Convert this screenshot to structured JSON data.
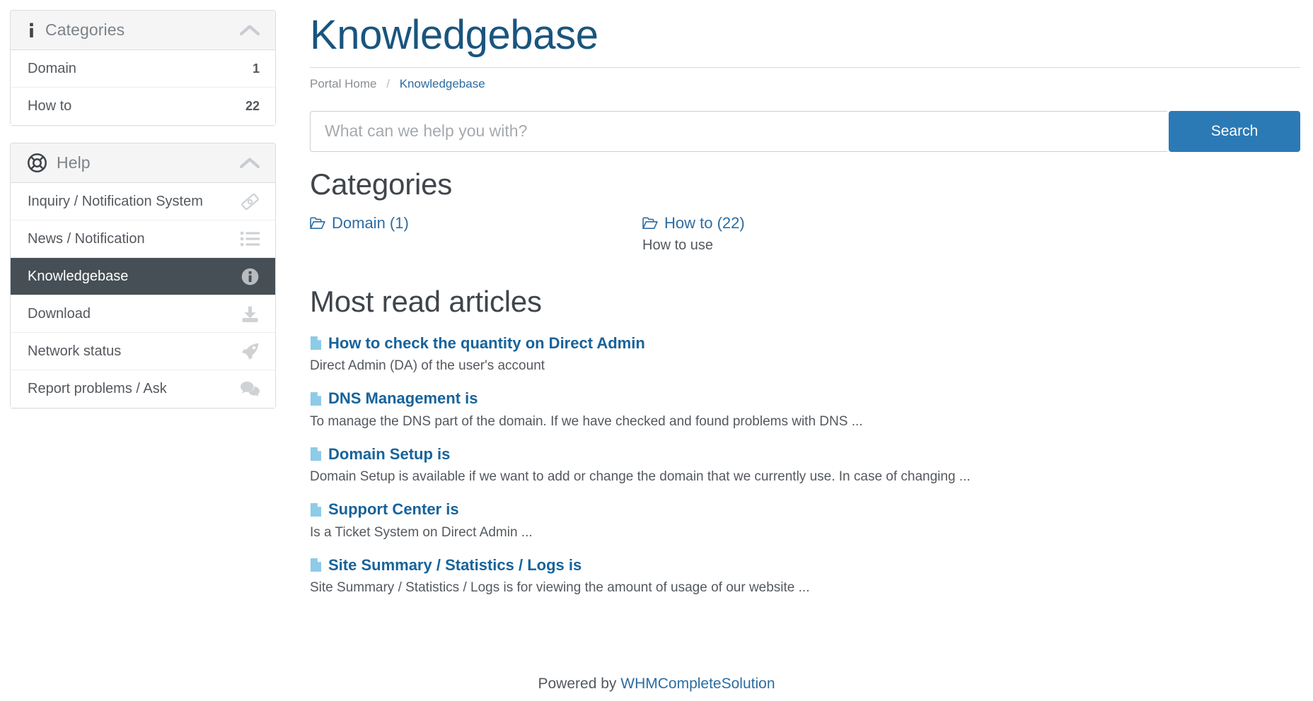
{
  "sidebar": {
    "categories_panel": {
      "title": "Categories",
      "icon": "info-icon",
      "collapse_icon": "chevron-up-icon",
      "items": [
        {
          "label": "Domain",
          "count": "1"
        },
        {
          "label": "How to",
          "count": "22"
        }
      ]
    },
    "help_panel": {
      "title": "Help",
      "icon": "life-ring-icon",
      "collapse_icon": "chevron-up-icon",
      "items": [
        {
          "label": "Inquiry / Notification System",
          "icon": "ticket-icon",
          "active": false
        },
        {
          "label": "News / Notification",
          "icon": "list-icon",
          "active": false
        },
        {
          "label": "Knowledgebase",
          "icon": "info-circle-icon",
          "active": true
        },
        {
          "label": "Download",
          "icon": "download-inbox-icon",
          "active": false
        },
        {
          "label": "Network status",
          "icon": "rocket-icon",
          "active": false
        },
        {
          "label": "Report problems / Ask",
          "icon": "comments-icon",
          "active": false
        }
      ]
    }
  },
  "main": {
    "page_title": "Knowledgebase",
    "breadcrumb": {
      "home": "Portal Home",
      "separator": "/",
      "current": "Knowledgebase"
    },
    "search": {
      "placeholder": "What can we help you with?",
      "value": "",
      "button_label": "Search"
    },
    "categories_heading": "Categories",
    "categories": [
      {
        "label": "Domain (1)",
        "description": "",
        "icon": "open-folder-icon"
      },
      {
        "label": "How to (22)",
        "description": "How to use",
        "icon": "open-folder-icon"
      }
    ],
    "articles_heading": "Most read articles",
    "articles": [
      {
        "title": "How to check the quantity on Direct Admin",
        "description": "Direct Admin (DA) of the user's account",
        "icon": "file-icon"
      },
      {
        "title": "DNS Management is",
        "description": "To manage the DNS part of the domain. If we have checked and found problems with DNS ...",
        "icon": "file-icon"
      },
      {
        "title": "Domain Setup is",
        "description": "Domain Setup is available if we want to add or change the domain that we currently use. In case of changing ...",
        "icon": "file-icon"
      },
      {
        "title": "Support Center is",
        "description": "Is a Ticket System on Direct Admin ...",
        "icon": "file-icon"
      },
      {
        "title": "Site Summary / Statistics / Logs is",
        "description": "Site Summary / Statistics / Logs is for viewing the amount of usage of our website ...",
        "icon": "file-icon"
      }
    ]
  },
  "footer": {
    "text": "Powered by",
    "link": "WHMCompleteSolution"
  },
  "colors": {
    "title_blue": "#19557f",
    "link_blue": "#2d6ca2",
    "article_blue": "#17639b",
    "button_blue": "#2b7ab5",
    "active_slate": "#464f55",
    "file_icon_blue": "#8ecbe8",
    "panel_head_bg": "#f5f5f5"
  }
}
